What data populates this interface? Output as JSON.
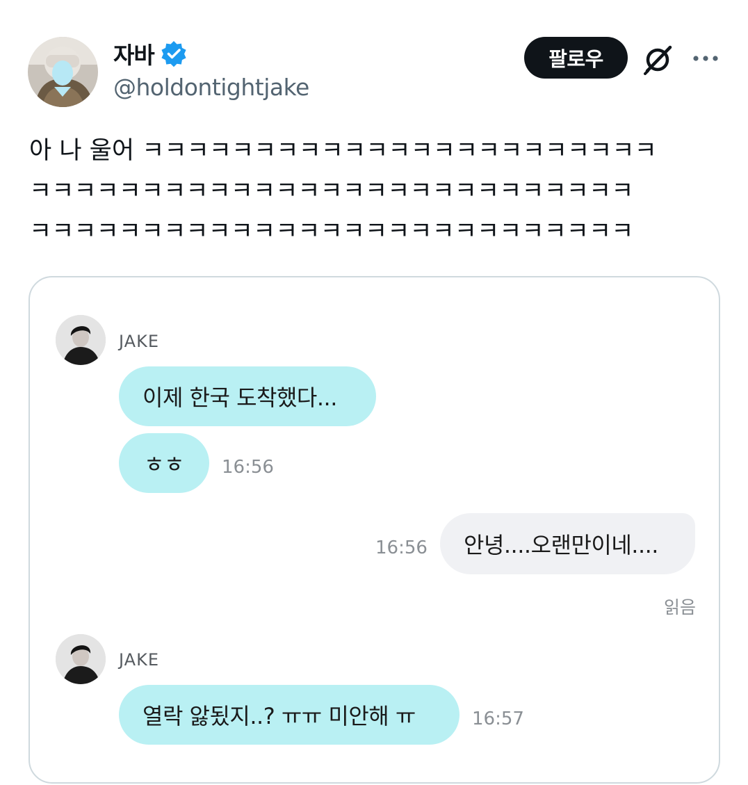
{
  "author": {
    "display_name": "자바",
    "handle": "@holdontightjake",
    "verified": true,
    "avatar_icon": "profile-photo-avatar"
  },
  "actions": {
    "follow_label": "팔로우",
    "grok_icon": "grok-slash-icon",
    "more_icon": "more-dots-icon"
  },
  "tweet": {
    "text": "아 나 울어 ㅋㅋㅋㅋㅋㅋㅋㅋㅋㅋㅋㅋㅋㅋㅋㅋㅋㅋㅋㅋㅋㅋㅋ\nㅋㅋㅋㅋㅋㅋㅋㅋㅋㅋㅋㅋㅋㅋㅋㅋㅋㅋㅋㅋㅋㅋㅋㅋㅋㅋㅋ\nㅋㅋㅋㅋㅋㅋㅋㅋㅋㅋㅋㅋㅋㅋㅋㅋㅋㅋㅋㅋㅋㅋㅋㅋㅋㅋㅋ"
  },
  "chat": {
    "messages_group_1": {
      "sender": "JAKE",
      "bubble_1": "이제 한국 도착했다...",
      "bubble_2": "ㅎㅎ",
      "time": "16:56"
    },
    "reply": {
      "text": "안녕....오랜만이네....",
      "time": "16:56",
      "read_label": "읽음"
    },
    "messages_group_2": {
      "sender": "JAKE",
      "bubble_1": "열락 앓됬지..? ㅠㅠ 미안해 ㅠ",
      "time": "16:57"
    }
  },
  "colors": {
    "verified_blue": "#1d9bf0",
    "incoming_bubble": "#b9f0f3",
    "outgoing_bubble": "#f0f1f4",
    "follow_bg": "#0f1419"
  }
}
